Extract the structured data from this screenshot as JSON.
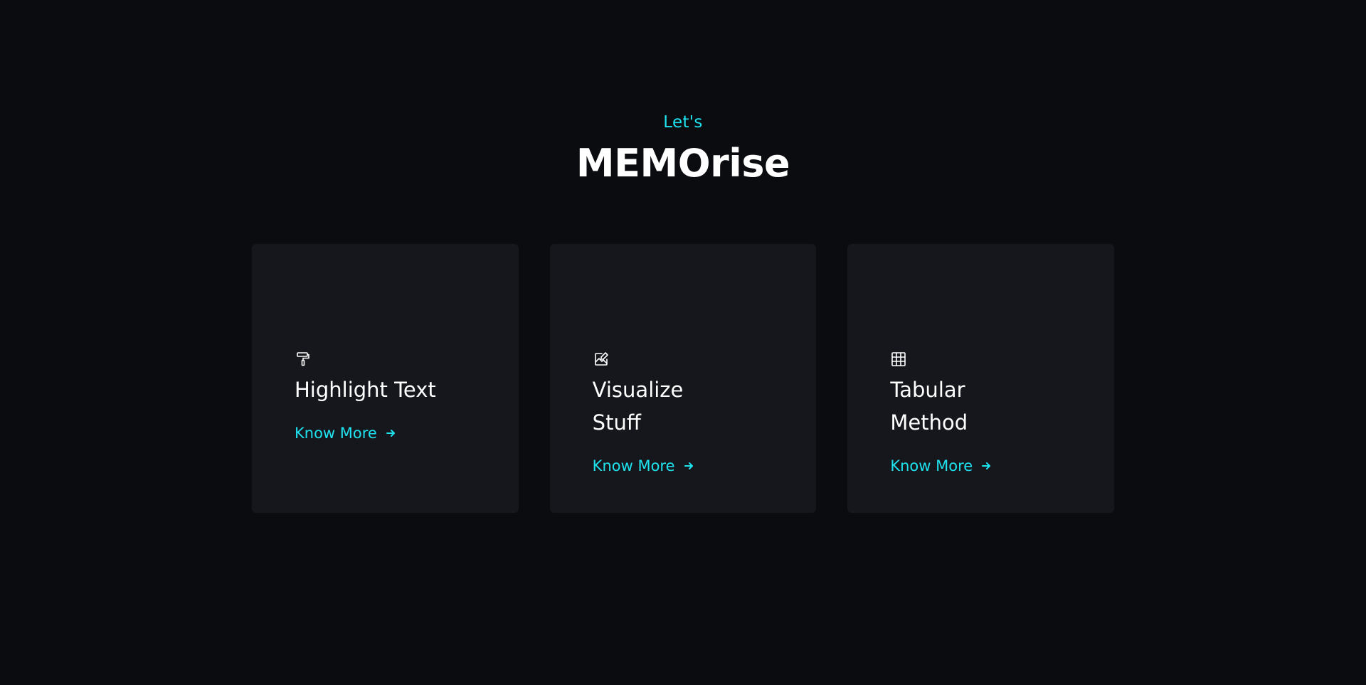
{
  "hero": {
    "eyebrow": "Let's",
    "title": "MEMOrise"
  },
  "colors": {
    "background": "#0b0c10",
    "card": "#16171c",
    "accent": "#1fe2ef",
    "text": "#ffffff"
  },
  "cards": [
    {
      "icon": "paint-roller-icon",
      "title": "Highlight Text",
      "link_label": "Know More",
      "link_icon": "arrow-right-icon"
    },
    {
      "icon": "image-edit-icon",
      "title": "Visualize Stuff",
      "link_label": "Know More",
      "link_icon": "arrow-right-icon"
    },
    {
      "icon": "table-grid-icon",
      "title": "Tabular Method",
      "link_label": "Know More",
      "link_icon": "arrow-right-icon"
    }
  ]
}
